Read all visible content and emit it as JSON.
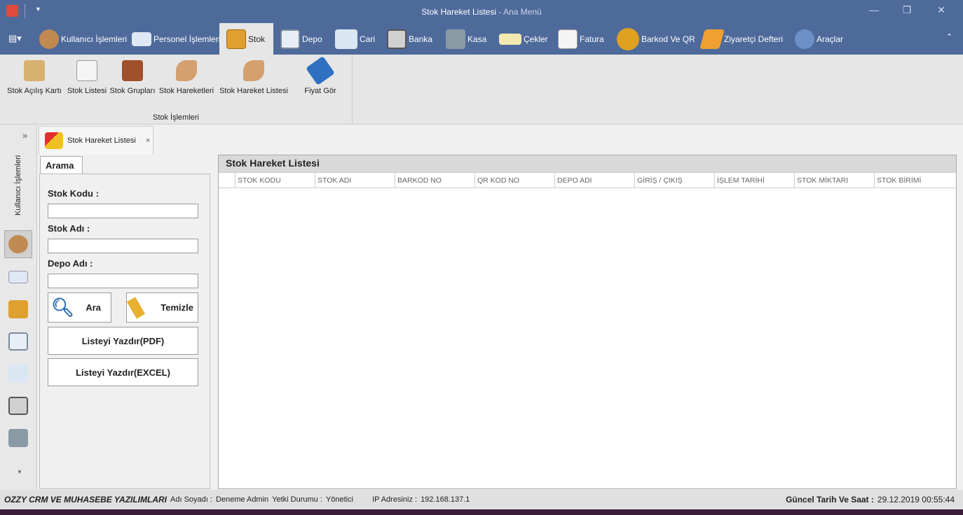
{
  "window": {
    "title": "Stok Hareket Listesi",
    "subtitle": "- Ana Menü"
  },
  "tabs": [
    {
      "label": "Kullanıcı İşlemleri",
      "icon": "user-info-icon"
    },
    {
      "label": "Personel İşlemleri",
      "icon": "id-card-icon"
    },
    {
      "label": "Stok",
      "icon": "crate-icon"
    },
    {
      "label": "Depo",
      "icon": "house-icon"
    },
    {
      "label": "Cari",
      "icon": "badge-icon"
    },
    {
      "label": "Banka",
      "icon": "bank-icon"
    },
    {
      "label": "Kasa",
      "icon": "safe-icon"
    },
    {
      "label": "Çekler",
      "icon": "check-icon"
    },
    {
      "label": "Fatura",
      "icon": "invoice-icon"
    },
    {
      "label": "Barkod Ve QR",
      "icon": "barcode-icon"
    },
    {
      "label": "Ziyaretçi Defteri",
      "icon": "guestbook-icon"
    },
    {
      "label": "Araçlar",
      "icon": "gears-icon"
    }
  ],
  "ribbon": {
    "group": "Stok İşlemleri",
    "buttons": [
      {
        "label": "Stok Açılış Kartı"
      },
      {
        "label": "Stok Listesi"
      },
      {
        "label": "Stok Grupları"
      },
      {
        "label": "Stok Hareketleri"
      },
      {
        "label": "Stok Hareket Listesi"
      },
      {
        "label": "Fiyat Gör"
      }
    ]
  },
  "leftnav": {
    "caption": "Kullanıcı İşlemleri"
  },
  "doctab": {
    "label": "Stok Hareket Listesi"
  },
  "search": {
    "tab": "Arama",
    "stok_kodu": "Stok Kodu :",
    "stok_adi": "Stok Adı :",
    "depo_adi": "Depo Adı :",
    "ara": "Ara",
    "temizle": "Temizle",
    "pdf": "Listeyi Yazdır(PDF)",
    "excel": "Listeyi Yazdır(EXCEL)"
  },
  "grid": {
    "caption": "Stok Hareket Listesi",
    "columns": [
      "STOK KODU",
      "STOK ADI",
      "BARKOD NO",
      "QR KOD NO",
      "DEPO ADI",
      "GİRİŞ / ÇIKIŞ",
      "İŞLEM TARİHİ",
      "STOK MİKTARI",
      "STOK BİRİMİ"
    ]
  },
  "status": {
    "company": "OZZY CRM VE MUHASEBE YAZILIMLARI",
    "name_label": "Adı Soyadı :",
    "name": "Deneme Admin",
    "role_label": "Yetki Durumu :",
    "role": "Yönetici",
    "ip_label": "IP Adresiniz :",
    "ip": "192.168.137.1",
    "date_label": "Güncel Tarih Ve Saat :",
    "date": "29.12.2019 00:55:44"
  },
  "colors": {
    "title_bar": "#4e6a9b",
    "ribbon": "#e6e6e6"
  }
}
